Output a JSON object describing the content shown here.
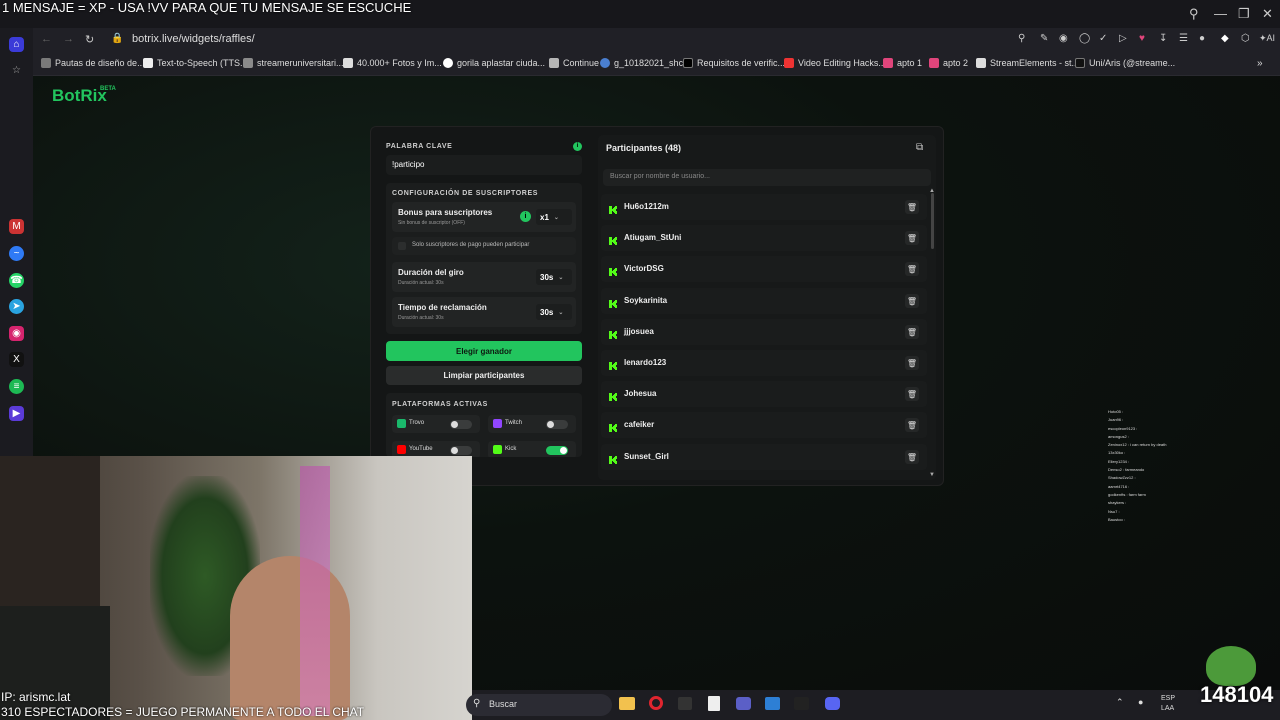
{
  "overlay": {
    "top_text": "1 MENSAJE = XP - USA !VV PARA QUE TU MENSAJE SE ESCUCHE",
    "ip_text": "IP: arismc.lat",
    "spectators_text": "310 ESPECTADORES = JUEGO PERMANENTE A TODO EL CHAT",
    "counter": "148104"
  },
  "browser": {
    "url": "botrix.live/widgets/raffles/",
    "bookmarks": [
      "Pautas de diseño de...",
      "Text-to-Speech (TTS...",
      "streameruniversitari...",
      "40.000+ Fotos y Im...",
      "gorila aplastar ciuda...",
      "Continue",
      "g_10182021_shcc",
      "Requisitos de verific...",
      "Video Editing Hacks...",
      "apto 1",
      "apto 2",
      "StreamElements - st...",
      "Uni/Aris (@streame..."
    ],
    "ai_label": "AI"
  },
  "app": {
    "logo": "BotRix",
    "logo_badge": "BETA",
    "keyword": {
      "label": "PALABRA CLAVE",
      "value": "!participo"
    },
    "subs_config": {
      "title": "CONFIGURACIÓN DE SUSCRIPTORES",
      "bonus_title": "Bonus para suscriptores",
      "bonus_sub": "Sin bonus de suscriptor (OFF)",
      "bonus_value": "x1",
      "paid_only": "Solo suscriptores de pago pueden participar",
      "spin_title": "Duración del giro",
      "spin_sub": "Duración actual: 30s",
      "spin_value": "30s",
      "claim_title": "Tiempo de reclamación",
      "claim_sub": "Duración actual: 30s",
      "claim_value": "30s"
    },
    "pick_winner": "Elegir ganador",
    "clear_participants": "Limpiar participantes",
    "platforms": {
      "title": "PLATAFORMAS ACTIVAS",
      "items": [
        {
          "name": "Trovo",
          "on": false,
          "color": "#1ab86b"
        },
        {
          "name": "Twitch",
          "on": false,
          "color": "#9146ff"
        },
        {
          "name": "YouTube",
          "on": false,
          "color": "#ff0000"
        },
        {
          "name": "Kick",
          "on": true,
          "color": "#53fc18"
        }
      ]
    },
    "participants": {
      "title": "Participantes (48)",
      "search_placeholder": "Buscar por nombre de usuario...",
      "list": [
        "Hu6o1212m",
        "Atiugam_StUni",
        "VictorDSG",
        "Soykarinita",
        "jjjosuea",
        "lenardo123",
        "Johesua",
        "cafeiker",
        "Sunset_Girl"
      ]
    }
  },
  "taskbar": {
    "search": "Buscar",
    "lang1": "ESP",
    "lang2": "LAA"
  },
  "chat_lines": [
    "Hoto05 :",
    "Juan96 :",
    "escopleon9123 :",
    "amongus2 :",
    "Zeninox12 : i can return by death",
    "13x30ko :",
    "Ellery1234 :",
    "Denso2 : farmeando",
    "ShadowZzz12 :",
    "aamrt4716 :",
    "godkenfts : farm farm",
    "shaykers :",
    "Nsu7 :",
    "Baustoo :"
  ]
}
